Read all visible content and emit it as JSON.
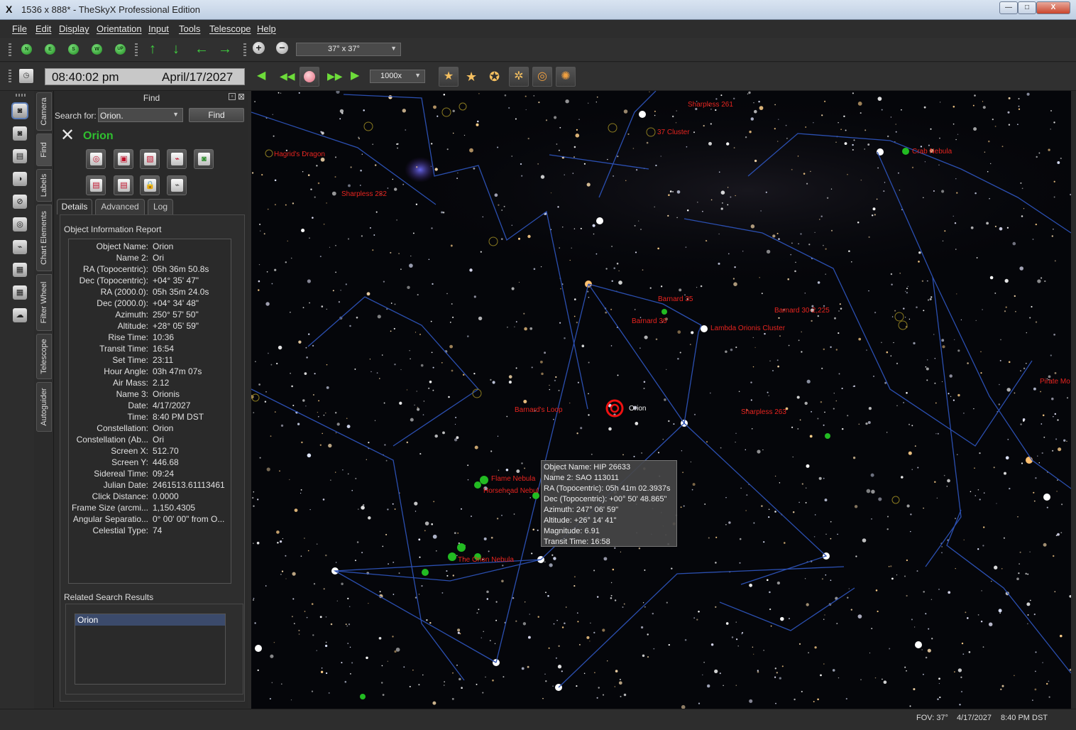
{
  "window": {
    "title": "1536 x 888* - TheSkyX Professional Edition",
    "app_icon": "X",
    "minimize": "—",
    "maximize": "□",
    "close": "X"
  },
  "menu": [
    "File",
    "Edit",
    "Display",
    "Orientation",
    "Input",
    "Tools",
    "Telescope",
    "Help"
  ],
  "orientation_toolbar": {
    "direction_buttons": [
      "N",
      "E",
      "S",
      "W",
      "UP"
    ],
    "fov_value": "37° x 37°"
  },
  "time_toolbar": {
    "time": "08:40:02 pm",
    "date": "April/17/2027",
    "step": "1000x"
  },
  "side_tabs": [
    "Camera",
    "Find",
    "Labels",
    "Chart Elements",
    "Filter Wheel",
    "Telescope",
    "Autoguider"
  ],
  "find": {
    "panel_title": "Find",
    "search_label": "Search for:",
    "search_value": "Orion.",
    "find_button": "Find",
    "result_name": "Orion",
    "tabs": [
      "Details",
      "Advanced",
      "Log"
    ],
    "report_title": "Object Information Report",
    "report": [
      {
        "k": "Object Name:",
        "v": "Orion"
      },
      {
        "k": "Name 2:",
        "v": "Ori"
      },
      {
        "k": "RA (Topocentric):",
        "v": "05h 36m 50.8s"
      },
      {
        "k": "Dec (Topocentric):",
        "v": "+04° 35' 47\""
      },
      {
        "k": "RA (2000.0):",
        "v": "05h 35m 24.0s"
      },
      {
        "k": "Dec (2000.0):",
        "v": "+04° 34' 48\""
      },
      {
        "k": "Azimuth:",
        "v": "250° 57' 50\""
      },
      {
        "k": "Altitude:",
        "v": "+28° 05' 59\""
      },
      {
        "k": "Rise Time:",
        "v": "10:36"
      },
      {
        "k": "Transit Time:",
        "v": "16:54"
      },
      {
        "k": "Set Time:",
        "v": "23:11"
      },
      {
        "k": "Hour Angle:",
        "v": "03h 47m 07s"
      },
      {
        "k": "Air Mass:",
        "v": "2.12"
      },
      {
        "k": "Name 3:",
        "v": "Orionis"
      },
      {
        "k": "Date:",
        "v": "4/17/2027"
      },
      {
        "k": "Time:",
        "v": "8:40 PM DST"
      },
      {
        "k": "Constellation:",
        "v": "Orion"
      },
      {
        "k": "Constellation (Ab...",
        "v": "Ori"
      },
      {
        "k": "Screen X:",
        "v": "512.70"
      },
      {
        "k": "Screen Y:",
        "v": "446.68"
      },
      {
        "k": "Sidereal Time:",
        "v": "09:24"
      },
      {
        "k": "Julian Date:",
        "v": "2461513.61113461"
      },
      {
        "k": "Click Distance:",
        "v": "0.0000"
      },
      {
        "k": "Frame Size (arcmi...",
        "v": "1,150.4305"
      },
      {
        "k": "Angular Separatio...",
        "v": "0° 00' 00\"  from O..."
      },
      {
        "k": "Celestial Type:",
        "v": "74"
      }
    ],
    "related_title": "Related Search Results",
    "related_items": [
      "Orion"
    ]
  },
  "sky": {
    "labels": [
      "Sharpless 261",
      "Hagrid's Dragon",
      "Sharpless 282",
      "37 Cluster",
      "Crab Nebula",
      "Barnard 35",
      "Barnard 36",
      "Lambda Orionis Cluster",
      "Barnard 30-2,225",
      "Barnard's Loop",
      "Orion",
      "Sharpless 263",
      "Pirate Mo",
      "Flame Nebula",
      "Horsehead Nebul",
      "The Orion Nebula"
    ],
    "tooltip": [
      "Object Name: HIP 26633",
      "Name 2: SAO 113011",
      "RA (Topocentric): 05h 41m 02.3937s",
      "Dec (Topocentric): +00° 50' 48.865\"",
      "Azimuth: 247° 06' 59\"",
      "Altitude: +26° 14' 41\"",
      "Magnitude: 6.91",
      "Transit Time: 16:58"
    ]
  },
  "status": {
    "fov": "FOV: 37°",
    "date": "4/17/2027",
    "time": "8:40 PM DST"
  }
}
